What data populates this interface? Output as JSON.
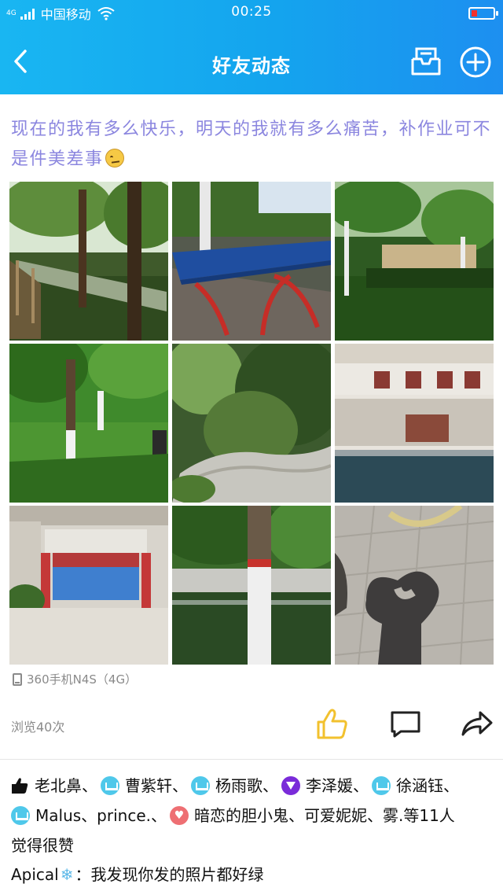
{
  "status_bar": {
    "network_tag": "4G",
    "carrier": "中国移动",
    "time": "00:25"
  },
  "nav": {
    "title": "好友动态",
    "icons": [
      "back-arrow-icon",
      "message-box-icon",
      "plus-circle-icon"
    ]
  },
  "post": {
    "text": "现在的我有多么快乐，明天的我就有多么痛苦，补作业可不是件美差事",
    "emoji": "confused-face-emoji",
    "photos": [
      "park-path-trees",
      "ping-pong-table",
      "park-lawn-trees",
      "sunlit-park-trees",
      "shrubs-and-rock",
      "building-courtyard",
      "courtyard-stage",
      "tree-by-pond",
      "heart-hands-shadow"
    ],
    "device": "360手机N4S（4G）",
    "views": "浏览40次"
  },
  "actions": {
    "like_icon": "thumbs-up-icon",
    "comment_icon": "comment-bubble-icon",
    "share_icon": "share-arrow-icon",
    "like_color": "#f2c12e"
  },
  "likes": {
    "names": [
      "老北鼻",
      "曹紫轩",
      "杨雨歌",
      "李泽媛",
      "徐涵钰",
      "Malus",
      "prince.",
      "暗恋的胆小鬼",
      "可爱妮妮",
      "雾."
    ],
    "sep": "、",
    "suffix": "等11人",
    "line3": "觉得很赞"
  },
  "comment": {
    "name": "Apical",
    "text": "：我发现你发的照片都好绿"
  },
  "colors": {
    "header_start": "#19b6f2",
    "header_end": "#1d8ff0",
    "post_text": "#8b86df",
    "muted": "#8a8a8a"
  }
}
